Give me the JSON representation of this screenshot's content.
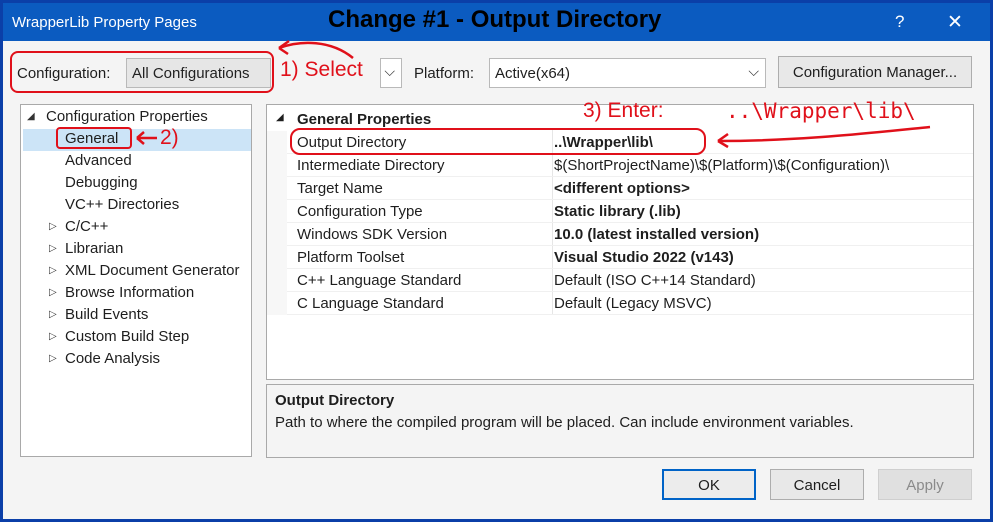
{
  "window": {
    "title": "WrapperLib Property Pages",
    "banner": "Change #1 - Output Directory",
    "help_glyph": "?",
    "close_glyph": "✕"
  },
  "toolbar": {
    "configuration_label": "Configuration:",
    "configuration_value": "All Configurations",
    "platform_label": "Platform:",
    "platform_value": "Active(x64)",
    "config_manager_label": "Configuration Manager...",
    "chevron_glyph": "⌵"
  },
  "tree": {
    "items": [
      {
        "label": "Configuration Properties",
        "arrow": "◢"
      },
      {
        "label": "General"
      },
      {
        "label": "Advanced"
      },
      {
        "label": "Debugging"
      },
      {
        "label": "VC++ Directories"
      },
      {
        "label": "C/C++",
        "arrow": "▷"
      },
      {
        "label": "Librarian",
        "arrow": "▷"
      },
      {
        "label": "XML Document Generator",
        "arrow": "▷"
      },
      {
        "label": "Browse Information",
        "arrow": "▷"
      },
      {
        "label": "Build Events",
        "arrow": "▷"
      },
      {
        "label": "Custom Build Step",
        "arrow": "▷"
      },
      {
        "label": "Code Analysis",
        "arrow": "▷"
      }
    ]
  },
  "grid": {
    "section_title": "General Properties",
    "section_arrow": "◢",
    "rows": [
      {
        "name": "Output Directory",
        "value": "..\\Wrapper\\lib\\"
      },
      {
        "name": "Intermediate Directory",
        "value": "$(ShortProjectName)\\$(Platform)\\$(Configuration)\\"
      },
      {
        "name": "Target Name",
        "value": "<different options>"
      },
      {
        "name": "Configuration Type",
        "value": "Static library (.lib)"
      },
      {
        "name": "Windows SDK Version",
        "value": "10.0 (latest installed version)"
      },
      {
        "name": "Platform Toolset",
        "value": "Visual Studio 2022 (v143)"
      },
      {
        "name": "C++ Language Standard",
        "value": "Default (ISO C++14 Standard)"
      },
      {
        "name": "C Language Standard",
        "value": "Default (Legacy MSVC)"
      }
    ]
  },
  "description": {
    "title": "Output Directory",
    "text": "Path to where the compiled program will be placed. Can include environment variables."
  },
  "buttons": {
    "ok": "OK",
    "cancel": "Cancel",
    "apply": "Apply"
  },
  "annotations": {
    "step1": "1) Select",
    "step2": "2)",
    "step3_label": "3) Enter:",
    "step3_value": "..\\Wrapper\\lib\\",
    "color": "#e0101a"
  }
}
